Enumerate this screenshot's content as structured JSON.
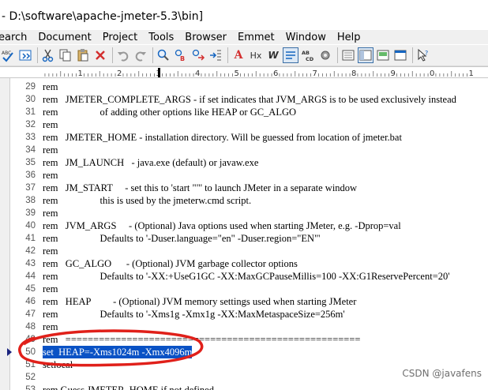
{
  "window": {
    "title": "- D:\\software\\apache-jmeter-5.3\\bin]"
  },
  "menu": {
    "items": [
      "earch",
      "Document",
      "Project",
      "Tools",
      "Browser",
      "Emmet",
      "Window",
      "Help"
    ]
  },
  "toolbar": {
    "icons": [
      "spellcheck-icon",
      "macro-icon",
      "cut-icon",
      "copy-icon",
      "paste-icon",
      "delete-icon",
      "undo-icon",
      "redo-icon",
      "find-icon",
      "replace-icon",
      "find-next-icon",
      "goto-icon",
      "font-icon",
      "hex-icon",
      "wordwrap-icon",
      "word-wrap-active-icon",
      "abc-icon",
      "settings-icon",
      "view-icon",
      "panel-icon",
      "preview-icon",
      "window-icon",
      "cursor-help-icon"
    ],
    "font_label": "A",
    "hex_label": "Hx",
    "w_label": "W"
  },
  "ruler": {
    "labels": [
      "1",
      "2",
      "3",
      "4",
      "5",
      "6",
      "7",
      "8",
      "9",
      "0",
      "1"
    ]
  },
  "editor": {
    "lines": [
      {
        "n": "29",
        "text": "rem"
      },
      {
        "n": "30",
        "text": "rem   JMETER_COMPLETE_ARGS - if set indicates that JVM_ARGS is to be used exclusively instead"
      },
      {
        "n": "31",
        "text": "rem                 of adding other options like HEAP or GC_ALGO"
      },
      {
        "n": "32",
        "text": "rem"
      },
      {
        "n": "33",
        "text": "rem   JMETER_HOME - installation directory. Will be guessed from location of jmeter.bat"
      },
      {
        "n": "34",
        "text": "rem"
      },
      {
        "n": "35",
        "text": "rem   JM_LAUNCH   - java.exe (default) or javaw.exe"
      },
      {
        "n": "36",
        "text": "rem"
      },
      {
        "n": "37",
        "text": "rem   JM_START     - set this to 'start \"\"' to launch JMeter in a separate window"
      },
      {
        "n": "38",
        "text": "rem                 this is used by the jmeterw.cmd script."
      },
      {
        "n": "39",
        "text": "rem"
      },
      {
        "n": "40",
        "text": "rem   JVM_ARGS     - (Optional) Java options used when starting JMeter, e.g. -Dprop=val"
      },
      {
        "n": "41",
        "text": "rem                 Defaults to '-Duser.language=\"en\" -Duser.region=\"EN\"'"
      },
      {
        "n": "42",
        "text": "rem"
      },
      {
        "n": "43",
        "text": "rem   GC_ALGO      - (Optional) JVM garbage collector options"
      },
      {
        "n": "44",
        "text": "rem                 Defaults to '-XX:+UseG1GC -XX:MaxGCPauseMillis=100 -XX:G1ReservePercent=20'"
      },
      {
        "n": "45",
        "text": "rem"
      },
      {
        "n": "46",
        "text": "rem   HEAP         - (Optional) JVM memory settings used when starting JMeter"
      },
      {
        "n": "47",
        "text": "rem                 Defaults to '-Xms1g -Xmx1g -XX:MaxMetaspaceSize=256m'"
      },
      {
        "n": "48",
        "text": "rem"
      },
      {
        "n": "49",
        "text": "rem   ====================================================="
      },
      {
        "n": "50",
        "text": "set  HEAP=-Xms1024m -Xmx4096m",
        "highlight": true
      },
      {
        "n": "51",
        "text": "setlocal"
      },
      {
        "n": "52",
        "text": ""
      },
      {
        "n": "53",
        "text": "rem Guess JMETER_HOME if not defined"
      }
    ]
  },
  "watermark": "CSDN @javafens",
  "colors": {
    "selection": "#0a52c5",
    "annotation_circle": "#e0201a",
    "bookmark": "#1a237e"
  }
}
